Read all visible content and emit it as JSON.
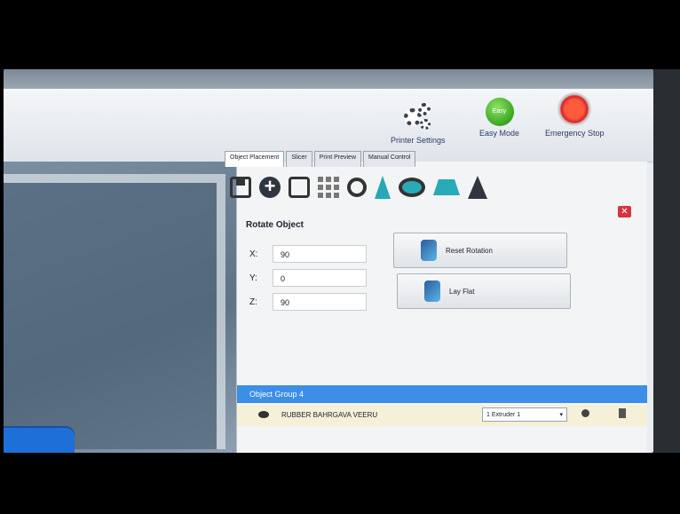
{
  "toolbar": {
    "printer_settings": "Printer Settings",
    "easy_mode": "Easy Mode",
    "easy_mode_badge": "Easy",
    "emergency_stop": "Emergency Stop"
  },
  "tabs": [
    "Object Placement",
    "Slicer",
    "Print Preview",
    "Manual Control"
  ],
  "icon_names": [
    "save-icon",
    "add-object-icon",
    "copy-icon",
    "grid-icon",
    "center-object-icon",
    "cone-icon",
    "mirror-icon",
    "scale-icon",
    "rocket-icon"
  ],
  "rotate": {
    "title": "Rotate Object",
    "x_label": "X:",
    "y_label": "Y:",
    "z_label": "Z:",
    "x_value": "90",
    "y_value": "0",
    "z_value": "90",
    "reset_rotation": "Reset Rotation",
    "lay_flat": "Lay Flat"
  },
  "close_label": "✕",
  "group": {
    "title": "Object Group 4",
    "item_name": "RUBBER BAHRGAVA VEERU",
    "extruder": "1 Extruder 1",
    "extruder_arrow": "▾"
  },
  "colors": {
    "accent": "#3c8ee6",
    "stop_red": "#d8202a",
    "easy_green": "#3aa51c",
    "close_red": "#d6343c"
  }
}
